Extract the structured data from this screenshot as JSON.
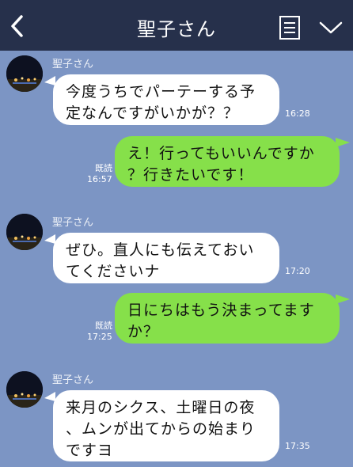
{
  "header": {
    "title": "聖子さん",
    "back_icon": "chevron-left-icon",
    "memo_icon": "note-icon",
    "menu_icon": "chevron-down-icon"
  },
  "colors": {
    "header_bg": "#26304b",
    "chat_bg": "#7c95c4",
    "incoming_bubble": "#ffffff",
    "outgoing_bubble": "#86e04a"
  },
  "messages": [
    {
      "direction": "in",
      "sender": "聖子さん",
      "text": "今度うちでパーテーする予\n定なんですがいかが？？",
      "time": "16:28"
    },
    {
      "direction": "out",
      "read": "既読",
      "text": "え！行ってもいいんですか\n？行きたいです！",
      "time": "16:57"
    },
    {
      "direction": "in",
      "sender": "聖子さん",
      "text": "ぜひ。直人にも伝えておい\nてくださいナ",
      "time": "17:20"
    },
    {
      "direction": "out",
      "read": "既読",
      "text": "日にちはもう決まってます\nか？",
      "time": "17:25"
    },
    {
      "direction": "in",
      "sender": "聖子さん",
      "text": "来月のシクス、土曜日の夜\n、ムンが出てからの始まり\nですヨ",
      "time": "17:35"
    }
  ]
}
